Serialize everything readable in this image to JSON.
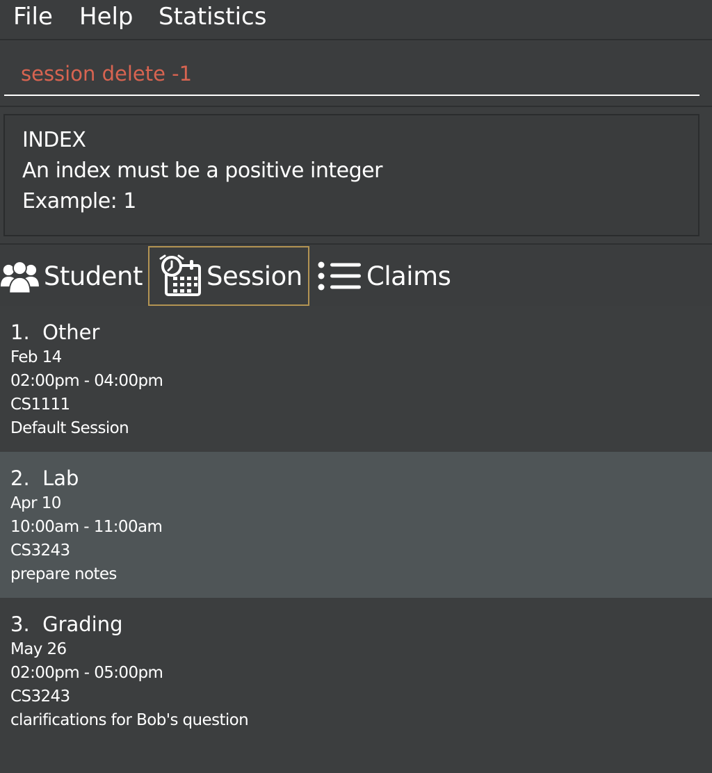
{
  "menu": {
    "file": "File",
    "help": "Help",
    "statistics": "Statistics"
  },
  "command": {
    "value": "session delete -1"
  },
  "result": {
    "line1": "INDEX",
    "line2": "An index must be a positive integer",
    "line3": "Example: 1"
  },
  "tabs": {
    "student": "Student",
    "session": "Session",
    "claims": "Claims",
    "active": "session",
    "active_border_color": "#b39453"
  },
  "sessions": [
    {
      "index": "1.",
      "type": "Other",
      "date": "Feb 14",
      "time": "02:00pm - 04:00pm",
      "module": "CS1111",
      "remark": "Default Session"
    },
    {
      "index": "2.",
      "type": "Lab",
      "date": "Apr 10",
      "time": "10:00am - 11:00am",
      "module": "CS3243",
      "remark": "prepare notes",
      "selected": true
    },
    {
      "index": "3.",
      "type": "Grading",
      "date": "May 26",
      "time": "02:00pm - 05:00pm",
      "module": "CS3243",
      "remark": "clarifications for Bob's question"
    }
  ],
  "colors": {
    "background": "#3c3e3f",
    "selected_row": "#4f5557",
    "command_text": "#d86451"
  },
  "icons": {
    "student": "people-icon",
    "session": "calendar-clock-icon",
    "claims": "list-icon"
  }
}
